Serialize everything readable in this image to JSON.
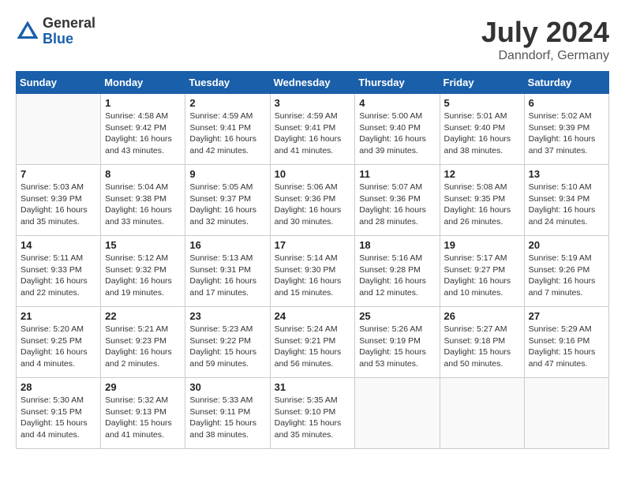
{
  "logo": {
    "general": "General",
    "blue": "Blue"
  },
  "title": {
    "month_year": "July 2024",
    "location": "Danndorf, Germany"
  },
  "calendar": {
    "headers": [
      "Sunday",
      "Monday",
      "Tuesday",
      "Wednesday",
      "Thursday",
      "Friday",
      "Saturday"
    ],
    "weeks": [
      [
        {
          "day": "",
          "info": ""
        },
        {
          "day": "1",
          "info": "Sunrise: 4:58 AM\nSunset: 9:42 PM\nDaylight: 16 hours\nand 43 minutes."
        },
        {
          "day": "2",
          "info": "Sunrise: 4:59 AM\nSunset: 9:41 PM\nDaylight: 16 hours\nand 42 minutes."
        },
        {
          "day": "3",
          "info": "Sunrise: 4:59 AM\nSunset: 9:41 PM\nDaylight: 16 hours\nand 41 minutes."
        },
        {
          "day": "4",
          "info": "Sunrise: 5:00 AM\nSunset: 9:40 PM\nDaylight: 16 hours\nand 39 minutes."
        },
        {
          "day": "5",
          "info": "Sunrise: 5:01 AM\nSunset: 9:40 PM\nDaylight: 16 hours\nand 38 minutes."
        },
        {
          "day": "6",
          "info": "Sunrise: 5:02 AM\nSunset: 9:39 PM\nDaylight: 16 hours\nand 37 minutes."
        }
      ],
      [
        {
          "day": "7",
          "info": "Sunrise: 5:03 AM\nSunset: 9:39 PM\nDaylight: 16 hours\nand 35 minutes."
        },
        {
          "day": "8",
          "info": "Sunrise: 5:04 AM\nSunset: 9:38 PM\nDaylight: 16 hours\nand 33 minutes."
        },
        {
          "day": "9",
          "info": "Sunrise: 5:05 AM\nSunset: 9:37 PM\nDaylight: 16 hours\nand 32 minutes."
        },
        {
          "day": "10",
          "info": "Sunrise: 5:06 AM\nSunset: 9:36 PM\nDaylight: 16 hours\nand 30 minutes."
        },
        {
          "day": "11",
          "info": "Sunrise: 5:07 AM\nSunset: 9:36 PM\nDaylight: 16 hours\nand 28 minutes."
        },
        {
          "day": "12",
          "info": "Sunrise: 5:08 AM\nSunset: 9:35 PM\nDaylight: 16 hours\nand 26 minutes."
        },
        {
          "day": "13",
          "info": "Sunrise: 5:10 AM\nSunset: 9:34 PM\nDaylight: 16 hours\nand 24 minutes."
        }
      ],
      [
        {
          "day": "14",
          "info": "Sunrise: 5:11 AM\nSunset: 9:33 PM\nDaylight: 16 hours\nand 22 minutes."
        },
        {
          "day": "15",
          "info": "Sunrise: 5:12 AM\nSunset: 9:32 PM\nDaylight: 16 hours\nand 19 minutes."
        },
        {
          "day": "16",
          "info": "Sunrise: 5:13 AM\nSunset: 9:31 PM\nDaylight: 16 hours\nand 17 minutes."
        },
        {
          "day": "17",
          "info": "Sunrise: 5:14 AM\nSunset: 9:30 PM\nDaylight: 16 hours\nand 15 minutes."
        },
        {
          "day": "18",
          "info": "Sunrise: 5:16 AM\nSunset: 9:28 PM\nDaylight: 16 hours\nand 12 minutes."
        },
        {
          "day": "19",
          "info": "Sunrise: 5:17 AM\nSunset: 9:27 PM\nDaylight: 16 hours\nand 10 minutes."
        },
        {
          "day": "20",
          "info": "Sunrise: 5:19 AM\nSunset: 9:26 PM\nDaylight: 16 hours\nand 7 minutes."
        }
      ],
      [
        {
          "day": "21",
          "info": "Sunrise: 5:20 AM\nSunset: 9:25 PM\nDaylight: 16 hours\nand 4 minutes."
        },
        {
          "day": "22",
          "info": "Sunrise: 5:21 AM\nSunset: 9:23 PM\nDaylight: 16 hours\nand 2 minutes."
        },
        {
          "day": "23",
          "info": "Sunrise: 5:23 AM\nSunset: 9:22 PM\nDaylight: 15 hours\nand 59 minutes."
        },
        {
          "day": "24",
          "info": "Sunrise: 5:24 AM\nSunset: 9:21 PM\nDaylight: 15 hours\nand 56 minutes."
        },
        {
          "day": "25",
          "info": "Sunrise: 5:26 AM\nSunset: 9:19 PM\nDaylight: 15 hours\nand 53 minutes."
        },
        {
          "day": "26",
          "info": "Sunrise: 5:27 AM\nSunset: 9:18 PM\nDaylight: 15 hours\nand 50 minutes."
        },
        {
          "day": "27",
          "info": "Sunrise: 5:29 AM\nSunset: 9:16 PM\nDaylight: 15 hours\nand 47 minutes."
        }
      ],
      [
        {
          "day": "28",
          "info": "Sunrise: 5:30 AM\nSunset: 9:15 PM\nDaylight: 15 hours\nand 44 minutes."
        },
        {
          "day": "29",
          "info": "Sunrise: 5:32 AM\nSunset: 9:13 PM\nDaylight: 15 hours\nand 41 minutes."
        },
        {
          "day": "30",
          "info": "Sunrise: 5:33 AM\nSunset: 9:11 PM\nDaylight: 15 hours\nand 38 minutes."
        },
        {
          "day": "31",
          "info": "Sunrise: 5:35 AM\nSunset: 9:10 PM\nDaylight: 15 hours\nand 35 minutes."
        },
        {
          "day": "",
          "info": ""
        },
        {
          "day": "",
          "info": ""
        },
        {
          "day": "",
          "info": ""
        }
      ]
    ]
  }
}
